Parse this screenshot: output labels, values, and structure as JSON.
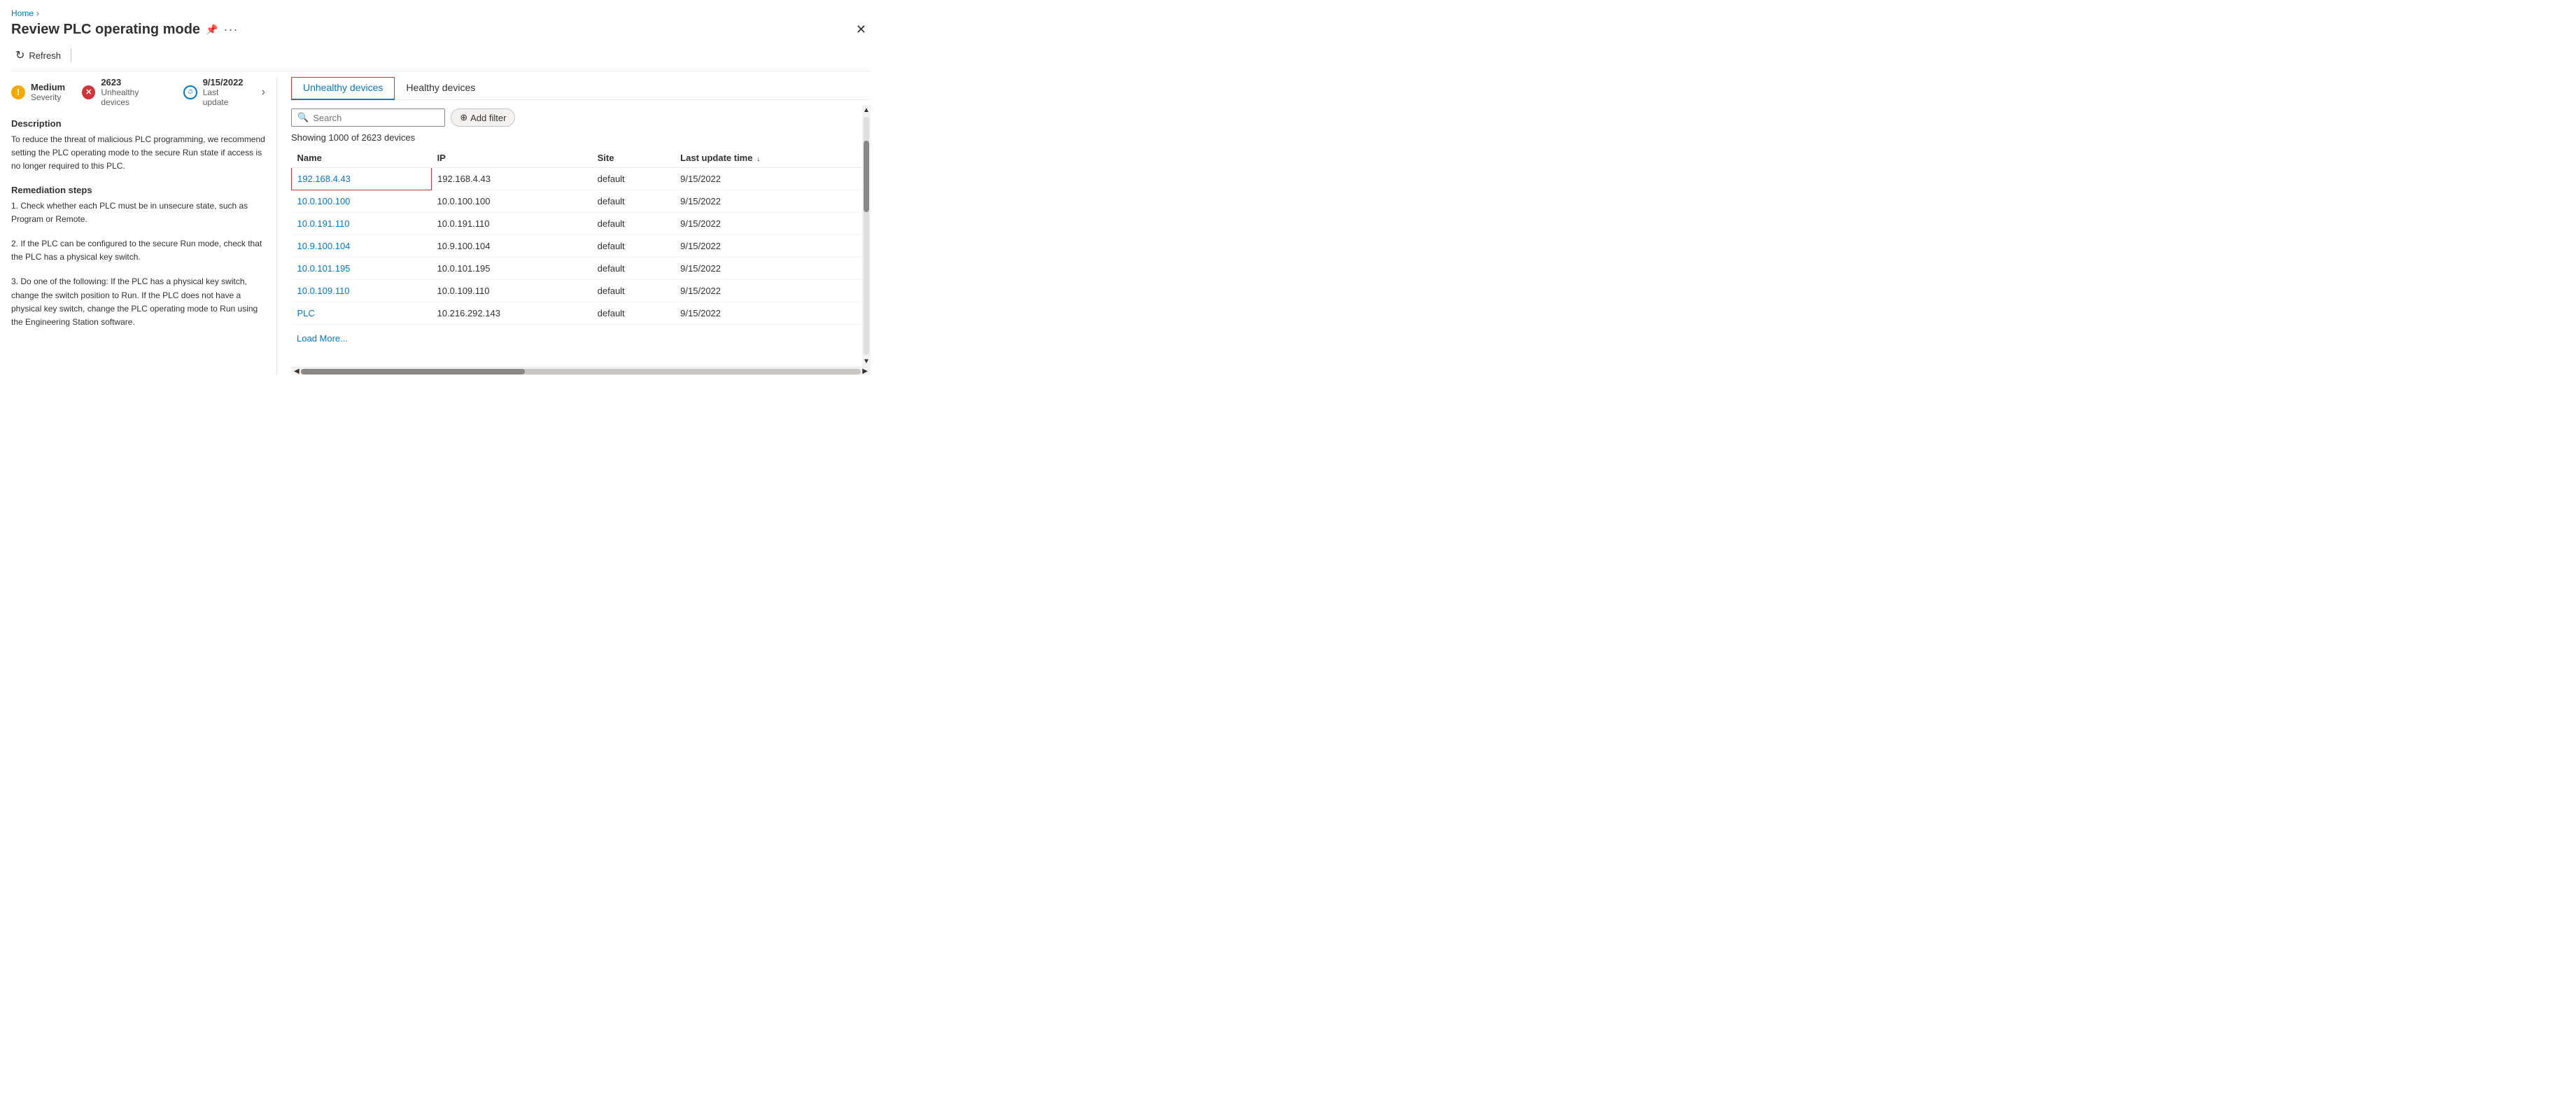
{
  "breadcrumb": {
    "home": "Home"
  },
  "header": {
    "title": "Review PLC operating mode",
    "pin_label": "📌",
    "more_label": "...",
    "close_label": "✕"
  },
  "toolbar": {
    "refresh_label": "Refresh"
  },
  "metrics": {
    "severity_label": "Severity",
    "severity_value": "Medium",
    "unhealthy_value": "2623",
    "unhealthy_label": "Unhealthy devices",
    "last_update_value": "9/15/2022",
    "last_update_label": "Last update"
  },
  "description": {
    "section_title": "Description",
    "text": "To reduce the threat of malicious PLC programming, we recommend setting the PLC operating mode to the secure Run state if access is no longer required to this PLC."
  },
  "remediation": {
    "section_title": "Remediation steps",
    "step1": "1. Check whether each PLC must be in unsecure state, such as Program or Remote.",
    "step2": "2. If the PLC can be configured to the secure Run mode, check that the PLC has a physical key switch.",
    "step3": "3. Do one of the following: If the PLC has a physical key switch, change the switch position to Run. If the PLC does not have a physical key switch, change the PLC operating mode to Run using the Engineering Station software."
  },
  "tabs": {
    "unhealthy": "Unhealthy devices",
    "healthy": "Healthy devices"
  },
  "search": {
    "placeholder": "Search"
  },
  "add_filter": {
    "label": "Add filter"
  },
  "showing_text": "Showing 1000 of 2623 devices",
  "table": {
    "columns": [
      "Name",
      "IP",
      "Site",
      "Last update time"
    ],
    "sort_col": "Last update time",
    "rows": [
      {
        "name": "192.168.4.43",
        "ip": "192.168.4.43",
        "site": "default",
        "last_update": "9/15/2022",
        "highlighted": true
      },
      {
        "name": "10.0.100.100",
        "ip": "10.0.100.100",
        "site": "default",
        "last_update": "9/15/2022",
        "highlighted": false
      },
      {
        "name": "10.0.191.110",
        "ip": "10.0.191.110",
        "site": "default",
        "last_update": "9/15/2022",
        "highlighted": false
      },
      {
        "name": "10.9.100.104",
        "ip": "10.9.100.104",
        "site": "default",
        "last_update": "9/15/2022",
        "highlighted": false
      },
      {
        "name": "10.0.101.195",
        "ip": "10.0.101.195",
        "site": "default",
        "last_update": "9/15/2022",
        "highlighted": false
      },
      {
        "name": "10.0.109.110",
        "ip": "10.0.109.110",
        "site": "default",
        "last_update": "9/15/2022",
        "highlighted": false
      },
      {
        "name": "PLC",
        "ip": "10.216.292.143",
        "site": "default",
        "last_update": "9/15/2022",
        "highlighted": false
      }
    ]
  },
  "load_more": "Load More...",
  "icons": {
    "severity": "!",
    "unhealthy": "✕",
    "clock": "⏱",
    "search": "🔍",
    "filter": "⊕",
    "pin": "📌",
    "more": "···",
    "refresh": "↻",
    "sort_desc": "↓"
  }
}
